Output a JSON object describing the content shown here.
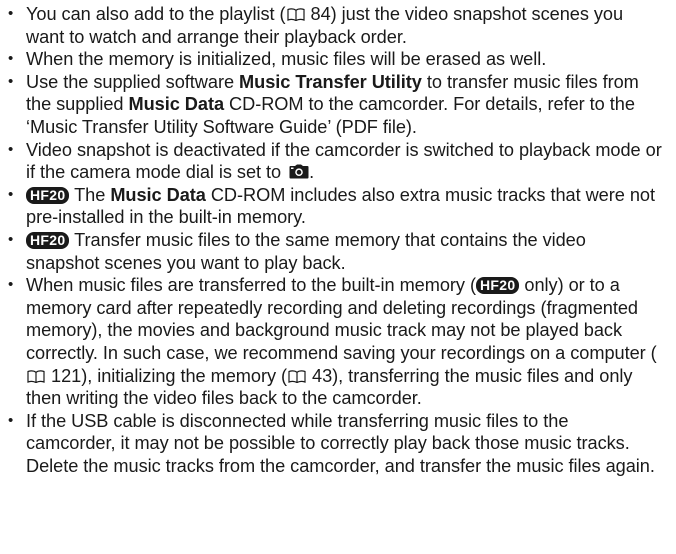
{
  "notes": [
    {
      "t1": "You can also add to the playlist (",
      "page": "84",
      "t2": ") just the video snapshot scenes you want to watch and arrange their playback order."
    },
    {
      "text": "When the memory is initialized, music files will be erased as well."
    },
    {
      "t1": "Use the supplied software ",
      "b1": "Music Transfer Utility",
      "t2": " to transfer music files from the supplied ",
      "b2": "Music Data",
      "t3": " CD-ROM to the camcorder. For details, refer to the ‘Music Transfer Utility Software Guide’ (PDF file)."
    },
    {
      "text": "Video snapshot is deactivated if the camcorder is switched to playback mode or if the camera mode dial is set to ",
      "icon": "camera-mode-icon",
      "end": "."
    },
    {
      "badge": "HF20",
      "t1": " The ",
      "b1": "Music Data",
      "t2": " CD-ROM includes also extra music tracks that were not pre-installed in the built-in memory."
    },
    {
      "badge": "HF20",
      "t1": " Transfer music files to the same memory that contains the video snapshot scenes you want to play back."
    },
    {
      "t1": "When music files are transferred to the built-in memory (",
      "badge": "HF20",
      "t2": " only) or to a memory card after repeatedly recording and deleting recordings (fragmented memory), the movies and background music track may not be played back correctly. In such case, we recommend saving your recordings on a computer (",
      "page1": "121",
      "t3": "), initializing the memory (",
      "page2": "43",
      "t4": "), transferring the music files and only then writing the video files back to the camcorder."
    },
    {
      "text": "If the USB cable is disconnected while transferring music files to the camcorder, it may not be possible to correctly play back those music tracks. Delete the music tracks from the camcorder, and transfer the music files again."
    }
  ],
  "bullet": "•"
}
